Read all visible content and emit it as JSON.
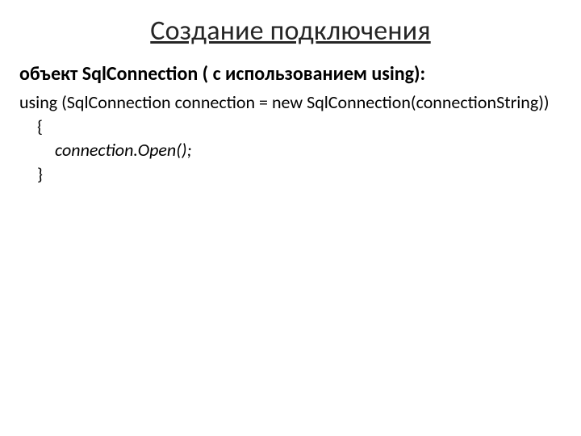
{
  "title": "Создание подключения",
  "subtitle": "объект SqlConnection ( с использованием using):",
  "code": {
    "line1": "using (SqlConnection connection = new SqlConnection(connectionString))",
    "open_brace": "{",
    "body": "connection.Open();",
    "close_brace": "}"
  }
}
